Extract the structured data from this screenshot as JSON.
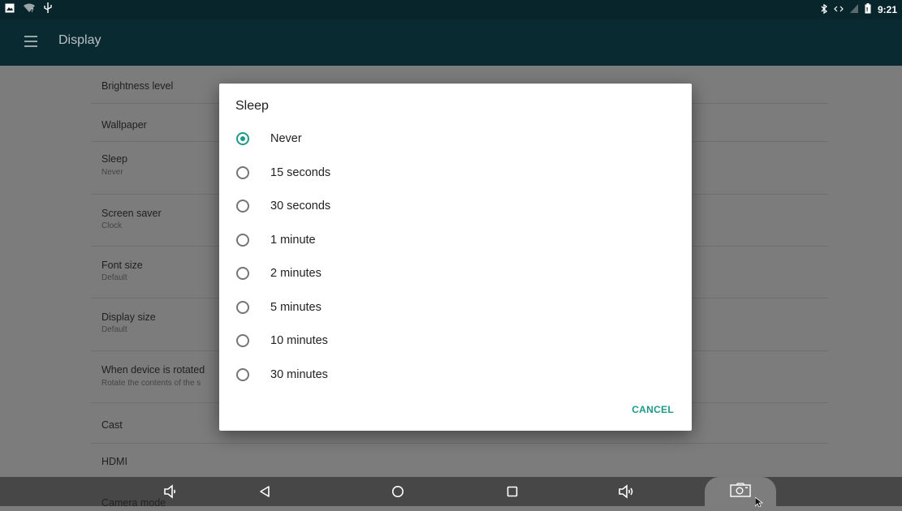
{
  "status_bar": {
    "left_icons": [
      "image-icon",
      "wifi-question-icon",
      "usb-icon"
    ],
    "right_icons": [
      "bluetooth-icon",
      "data-arrows-icon",
      "no-signal-icon",
      "battery-icon"
    ],
    "time": "9:21"
  },
  "app_bar": {
    "title": "Display"
  },
  "settings": [
    {
      "title": "Brightness level",
      "subtitle": ""
    },
    {
      "title": "Wallpaper",
      "subtitle": ""
    },
    {
      "title": "Sleep",
      "subtitle": "Never"
    },
    {
      "title": "Screen saver",
      "subtitle": "Clock"
    },
    {
      "title": "Font size",
      "subtitle": "Default"
    },
    {
      "title": "Display size",
      "subtitle": "Default"
    },
    {
      "title": "When device is rotated",
      "subtitle": "Rotate the contents of the s"
    },
    {
      "title": "Cast",
      "subtitle": ""
    },
    {
      "title": "HDMI",
      "subtitle": ""
    },
    {
      "title": "Camera mode",
      "subtitle": ""
    }
  ],
  "dialog": {
    "title": "Sleep",
    "selected": "Never",
    "options": [
      "Never",
      "15 seconds",
      "30 seconds",
      "1 minute",
      "2 minutes",
      "5 minutes",
      "10 minutes",
      "30 minutes"
    ],
    "cancel_label": "CANCEL"
  },
  "nav_bar": {
    "buttons": [
      "volume-down-icon",
      "back-icon",
      "home-icon",
      "recents-icon",
      "volume-up-icon",
      "screenshot-icon"
    ]
  },
  "colors": {
    "accent": "#1e9a87",
    "status_bar": "#08252b",
    "app_bar": "#0a2a32",
    "scrim_background": "#7c7c7c",
    "nav_bar": "#474747"
  }
}
